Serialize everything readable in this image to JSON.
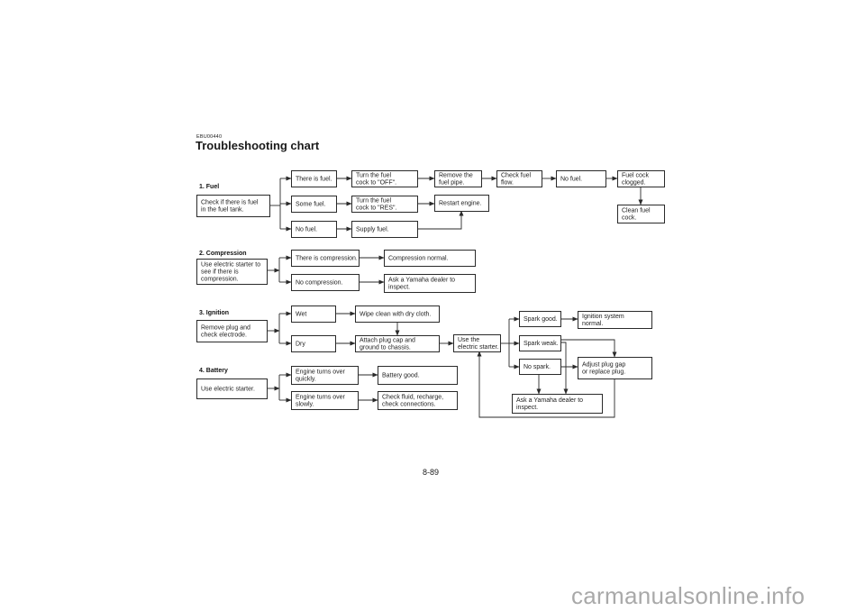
{
  "header": {
    "code": "EBU00440",
    "title": "Troubleshooting chart"
  },
  "footer": {
    "page_number": "8-89",
    "watermark": "carmanualsonline.info"
  },
  "sections": [
    {
      "id": "fuel",
      "label": "1. Fuel"
    },
    {
      "id": "compression",
      "label": "2. Compression"
    },
    {
      "id": "ignition",
      "label": "3. Ignition"
    },
    {
      "id": "battery",
      "label": "4. Battery"
    }
  ],
  "nodes": {
    "fuel_check": [
      "Check if there is fuel",
      "in the fuel tank."
    ],
    "there_is_fuel": [
      "There is fuel."
    ],
    "some_fuel": [
      "Some fuel."
    ],
    "no_fuel": [
      "No fuel."
    ],
    "cock_off": [
      "Turn the fuel",
      "cock to \"OFF\"."
    ],
    "cock_res": [
      "Turn the fuel",
      "cock to \"RES\"."
    ],
    "supply_fuel": [
      "Supply fuel."
    ],
    "remove_pipe": [
      "Remove the",
      "fuel pipe."
    ],
    "restart_engine": [
      "Restart engine."
    ],
    "check_flow": [
      "Check fuel",
      "flow."
    ],
    "no_fuel_flow": [
      "No fuel."
    ],
    "cock_clogged": [
      "Fuel cock",
      "clogged."
    ],
    "clean_cock": [
      "Clean fuel",
      "cock."
    ],
    "comp_check": [
      "Use electric starter to",
      "see if there is",
      "compression."
    ],
    "is_compression": [
      "There is compression."
    ],
    "no_compression": [
      "No compression."
    ],
    "comp_normal": [
      "Compression normal."
    ],
    "comp_dealer": [
      "Ask a Yamaha dealer to",
      "inspect."
    ],
    "ign_check": [
      "Remove plug and",
      "check electrode."
    ],
    "wet": [
      "Wet"
    ],
    "dry": [
      "Dry"
    ],
    "wipe": [
      "Wipe clean with dry cloth."
    ],
    "attach_cap": [
      "Attach plug cap and",
      "ground to chassis."
    ],
    "use_starter": [
      "Use the",
      "electric starter."
    ],
    "spark_good": [
      "Spark good."
    ],
    "spark_weak": [
      "Spark weak."
    ],
    "no_spark": [
      "No spark."
    ],
    "ign_normal": [
      "Ignition system",
      "normal."
    ],
    "adjust_plug": [
      "Adjust plug gap",
      "or replace plug."
    ],
    "ign_dealer": [
      "Ask a Yamaha dealer to",
      "inspect."
    ],
    "bat_check": [
      "Use electric starter."
    ],
    "turns_quick": [
      "Engine turns over",
      "quickly."
    ],
    "turns_slow": [
      "Engine turns over",
      "slowly."
    ],
    "battery_good": [
      "Battery good."
    ],
    "check_fluid": [
      "Check fluid, recharge,",
      "check connections."
    ]
  }
}
